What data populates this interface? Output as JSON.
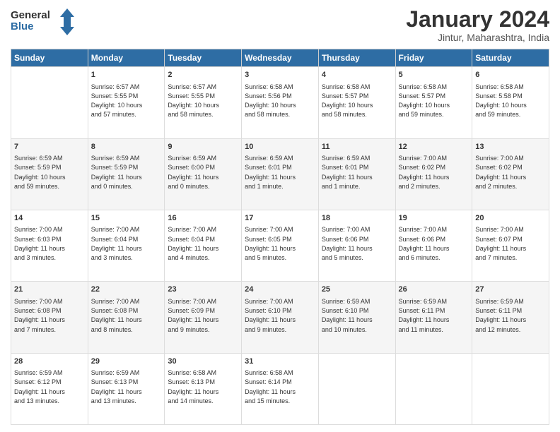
{
  "logo": {
    "text1": "General",
    "text2": "Blue"
  },
  "title": "January 2024",
  "subtitle": "Jintur, Maharashtra, India",
  "headers": [
    "Sunday",
    "Monday",
    "Tuesday",
    "Wednesday",
    "Thursday",
    "Friday",
    "Saturday"
  ],
  "weeks": [
    [
      {
        "day": "",
        "info": ""
      },
      {
        "day": "1",
        "info": "Sunrise: 6:57 AM\nSunset: 5:55 PM\nDaylight: 10 hours\nand 57 minutes."
      },
      {
        "day": "2",
        "info": "Sunrise: 6:57 AM\nSunset: 5:55 PM\nDaylight: 10 hours\nand 58 minutes."
      },
      {
        "day": "3",
        "info": "Sunrise: 6:58 AM\nSunset: 5:56 PM\nDaylight: 10 hours\nand 58 minutes."
      },
      {
        "day": "4",
        "info": "Sunrise: 6:58 AM\nSunset: 5:57 PM\nDaylight: 10 hours\nand 58 minutes."
      },
      {
        "day": "5",
        "info": "Sunrise: 6:58 AM\nSunset: 5:57 PM\nDaylight: 10 hours\nand 59 minutes."
      },
      {
        "day": "6",
        "info": "Sunrise: 6:58 AM\nSunset: 5:58 PM\nDaylight: 10 hours\nand 59 minutes."
      }
    ],
    [
      {
        "day": "7",
        "info": "Sunrise: 6:59 AM\nSunset: 5:59 PM\nDaylight: 10 hours\nand 59 minutes."
      },
      {
        "day": "8",
        "info": "Sunrise: 6:59 AM\nSunset: 5:59 PM\nDaylight: 11 hours\nand 0 minutes."
      },
      {
        "day": "9",
        "info": "Sunrise: 6:59 AM\nSunset: 6:00 PM\nDaylight: 11 hours\nand 0 minutes."
      },
      {
        "day": "10",
        "info": "Sunrise: 6:59 AM\nSunset: 6:01 PM\nDaylight: 11 hours\nand 1 minute."
      },
      {
        "day": "11",
        "info": "Sunrise: 6:59 AM\nSunset: 6:01 PM\nDaylight: 11 hours\nand 1 minute."
      },
      {
        "day": "12",
        "info": "Sunrise: 7:00 AM\nSunset: 6:02 PM\nDaylight: 11 hours\nand 2 minutes."
      },
      {
        "day": "13",
        "info": "Sunrise: 7:00 AM\nSunset: 6:02 PM\nDaylight: 11 hours\nand 2 minutes."
      }
    ],
    [
      {
        "day": "14",
        "info": "Sunrise: 7:00 AM\nSunset: 6:03 PM\nDaylight: 11 hours\nand 3 minutes."
      },
      {
        "day": "15",
        "info": "Sunrise: 7:00 AM\nSunset: 6:04 PM\nDaylight: 11 hours\nand 3 minutes."
      },
      {
        "day": "16",
        "info": "Sunrise: 7:00 AM\nSunset: 6:04 PM\nDaylight: 11 hours\nand 4 minutes."
      },
      {
        "day": "17",
        "info": "Sunrise: 7:00 AM\nSunset: 6:05 PM\nDaylight: 11 hours\nand 5 minutes."
      },
      {
        "day": "18",
        "info": "Sunrise: 7:00 AM\nSunset: 6:06 PM\nDaylight: 11 hours\nand 5 minutes."
      },
      {
        "day": "19",
        "info": "Sunrise: 7:00 AM\nSunset: 6:06 PM\nDaylight: 11 hours\nand 6 minutes."
      },
      {
        "day": "20",
        "info": "Sunrise: 7:00 AM\nSunset: 6:07 PM\nDaylight: 11 hours\nand 7 minutes."
      }
    ],
    [
      {
        "day": "21",
        "info": "Sunrise: 7:00 AM\nSunset: 6:08 PM\nDaylight: 11 hours\nand 7 minutes."
      },
      {
        "day": "22",
        "info": "Sunrise: 7:00 AM\nSunset: 6:08 PM\nDaylight: 11 hours\nand 8 minutes."
      },
      {
        "day": "23",
        "info": "Sunrise: 7:00 AM\nSunset: 6:09 PM\nDaylight: 11 hours\nand 9 minutes."
      },
      {
        "day": "24",
        "info": "Sunrise: 7:00 AM\nSunset: 6:10 PM\nDaylight: 11 hours\nand 9 minutes."
      },
      {
        "day": "25",
        "info": "Sunrise: 6:59 AM\nSunset: 6:10 PM\nDaylight: 11 hours\nand 10 minutes."
      },
      {
        "day": "26",
        "info": "Sunrise: 6:59 AM\nSunset: 6:11 PM\nDaylight: 11 hours\nand 11 minutes."
      },
      {
        "day": "27",
        "info": "Sunrise: 6:59 AM\nSunset: 6:11 PM\nDaylight: 11 hours\nand 12 minutes."
      }
    ],
    [
      {
        "day": "28",
        "info": "Sunrise: 6:59 AM\nSunset: 6:12 PM\nDaylight: 11 hours\nand 13 minutes."
      },
      {
        "day": "29",
        "info": "Sunrise: 6:59 AM\nSunset: 6:13 PM\nDaylight: 11 hours\nand 13 minutes."
      },
      {
        "day": "30",
        "info": "Sunrise: 6:58 AM\nSunset: 6:13 PM\nDaylight: 11 hours\nand 14 minutes."
      },
      {
        "day": "31",
        "info": "Sunrise: 6:58 AM\nSunset: 6:14 PM\nDaylight: 11 hours\nand 15 minutes."
      },
      {
        "day": "",
        "info": ""
      },
      {
        "day": "",
        "info": ""
      },
      {
        "day": "",
        "info": ""
      }
    ]
  ]
}
